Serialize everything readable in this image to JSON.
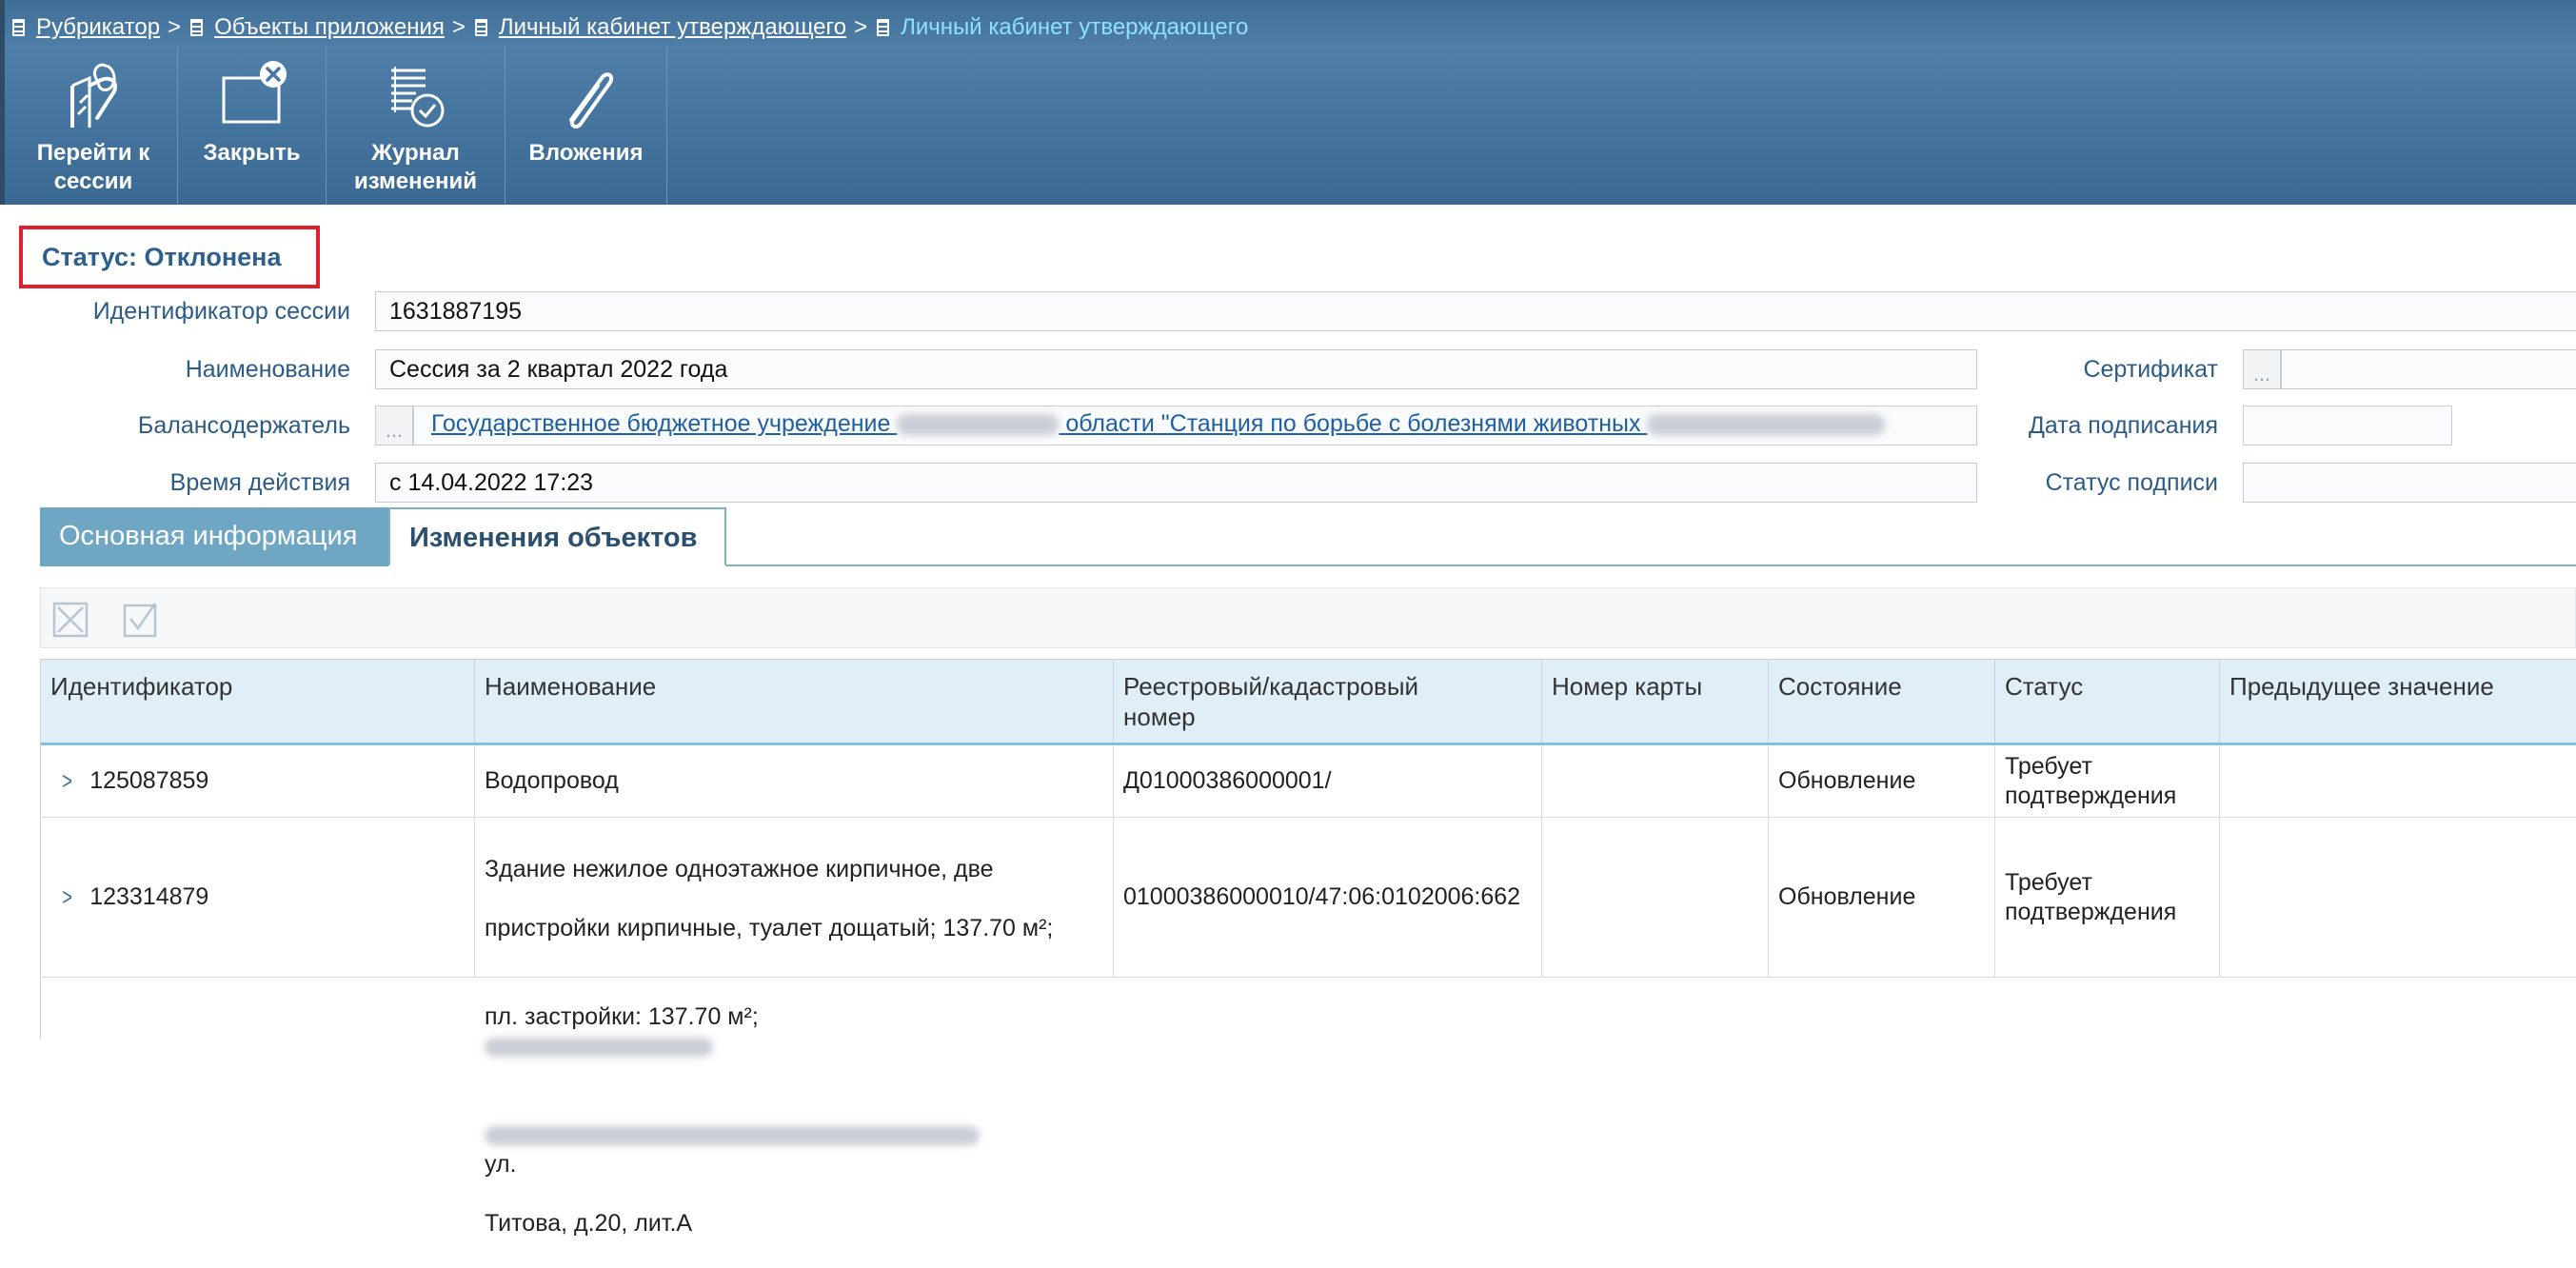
{
  "breadcrumb": {
    "items": [
      "Рубрикатор",
      "Объекты приложения",
      "Личный кабинет утверждающего"
    ],
    "current": "Личный кабинет утверждающего",
    "separator": ">"
  },
  "toolbar": {
    "buttons": [
      {
        "label": "Перейти к\nсессии",
        "icon": "go-to-session-icon"
      },
      {
        "label": "Закрыть",
        "icon": "close-window-icon"
      },
      {
        "label": "Журнал\nизменений",
        "icon": "change-log-icon"
      },
      {
        "label": "Вложения",
        "icon": "paperclip-icon"
      }
    ]
  },
  "status": "Статус: Отклонена",
  "form": {
    "session_id_label": "Идентификатор сессии",
    "session_id_value": "1631887195",
    "name_label": "Наименование",
    "name_value": "Сессия за 2 квартал 2022 года",
    "holder_label": "Балансодержатель",
    "holder_dots": "...",
    "holder_value_part1": "Государственное бюджетное учреждение",
    "holder_value_part2": "области \"Станция по борьбе с болезнями животных",
    "validity_label": "Время действия",
    "validity_value": "с 14.04.2022 17:23",
    "certificate_label": "Сертификат",
    "certificate_dots": "...",
    "sign_date_label": "Дата подписания",
    "sign_status_label": "Статус подписи"
  },
  "tabs": [
    {
      "label": "Основная информация",
      "active": false
    },
    {
      "label": "Изменения объектов",
      "active": true
    }
  ],
  "table": {
    "columns": [
      "Идентификатор",
      "Наименование",
      "Реестровый/кадастровый\nномер",
      "Номер карты",
      "Состояние",
      "Статус",
      "Предыдущее значение"
    ],
    "rows": [
      {
        "id": "125087859",
        "name_lines": [
          "Водопровод"
        ],
        "registry": "Д01000386000001/",
        "map_number": "",
        "state": "Обновление",
        "status": "Требует\nподтверждения",
        "previous": ""
      },
      {
        "id": "123314879",
        "name_lines": [
          "Здание нежилое одноэтажное кирпичное, две",
          "пристройки кирпичные, туалет дощатый; 137.70 м²;",
          "пл. застройки: 137.70 м²;",
          "ул.",
          "Титова, д.20, лит.А"
        ],
        "registry": "01000386000010/47:06:0102006:662",
        "map_number": "",
        "state": "Обновление",
        "status": "Требует\nподтверждения",
        "previous": ""
      }
    ]
  },
  "colors": {
    "header_bg": "#4a7aa3",
    "status_border": "#e0202c",
    "label_blue": "#2c5b86",
    "link_blue": "#1f5fa3",
    "tab_inactive": "#6fa6c3",
    "grid_header": "#e0eef8"
  }
}
